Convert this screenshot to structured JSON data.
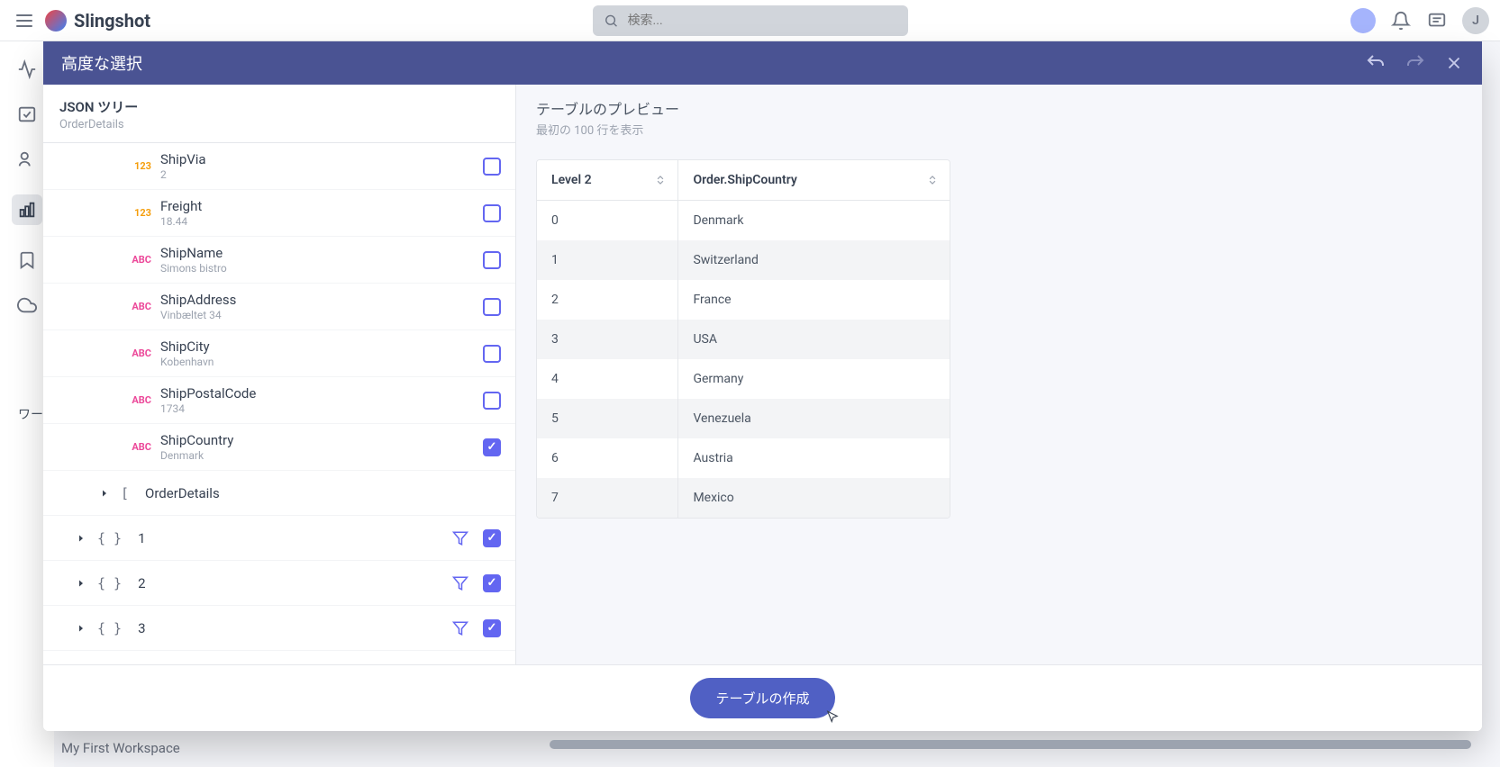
{
  "app": {
    "name": "Slingshot",
    "search_placeholder": "検索...",
    "avatar_initial": "J"
  },
  "modal": {
    "title": "高度な選択",
    "create_button": "テーブルの作成"
  },
  "tree": {
    "title": "JSON ツリー",
    "subtitle": "OrderDetails",
    "fields": [
      {
        "type": "123",
        "name": "ShipVia",
        "value": "2",
        "checked": false
      },
      {
        "type": "123",
        "name": "Freight",
        "value": "18.44",
        "checked": false
      },
      {
        "type": "ABC",
        "name": "ShipName",
        "value": "Simons bistro",
        "checked": false
      },
      {
        "type": "ABC",
        "name": "ShipAddress",
        "value": "Vinbæltet 34",
        "checked": false
      },
      {
        "type": "ABC",
        "name": "ShipCity",
        "value": "Kobenhavn",
        "checked": false
      },
      {
        "type": "ABC",
        "name": "ShipPostalCode",
        "value": "1734",
        "checked": false
      },
      {
        "type": "ABC",
        "name": "ShipCountry",
        "value": "Denmark",
        "checked": true
      }
    ],
    "nodes": [
      {
        "brace": "[",
        "label": "OrderDetails",
        "filter": false,
        "check": false,
        "depth": 1
      },
      {
        "brace": "{ }",
        "label": "1",
        "filter": true,
        "check": true,
        "depth": 0
      },
      {
        "brace": "{ }",
        "label": "2",
        "filter": true,
        "check": true,
        "depth": 0
      },
      {
        "brace": "{ }",
        "label": "3",
        "filter": true,
        "check": true,
        "depth": 0
      }
    ]
  },
  "preview": {
    "title": "テーブルのプレビュー",
    "subtitle": "最初の 100 行を表示",
    "columns": [
      "Level 2",
      "Order.ShipCountry"
    ],
    "rows": [
      [
        "0",
        "Denmark"
      ],
      [
        "1",
        "Switzerland"
      ],
      [
        "2",
        "France"
      ],
      [
        "3",
        "USA"
      ],
      [
        "4",
        "Germany"
      ],
      [
        "5",
        "Venezuela"
      ],
      [
        "6",
        "Austria"
      ],
      [
        "7",
        "Mexico"
      ]
    ]
  },
  "background": {
    "workspace_label_truncated": "My First Workspace",
    "side_label_truncated": "ワー"
  }
}
